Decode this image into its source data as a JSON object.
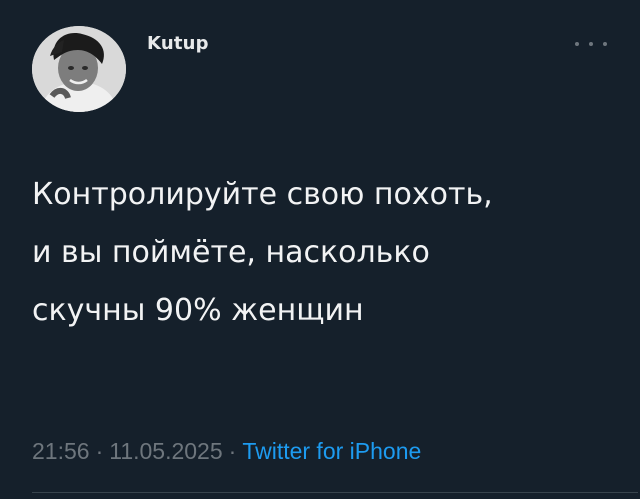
{
  "tweet": {
    "author": "Kutup",
    "text": "Контролируйте свою похоть,\nи вы поймёте, насколько\nскучны 90% женщин",
    "time": "21:56",
    "date": "11.05.2025",
    "separator": "·",
    "source": "Twitter for iPhone"
  },
  "icons": {
    "more": "more-horizontal-icon"
  },
  "colors": {
    "background": "#15202b",
    "text": "#e7e9ea",
    "muted": "#6e767d",
    "link": "#1d9bf0"
  }
}
